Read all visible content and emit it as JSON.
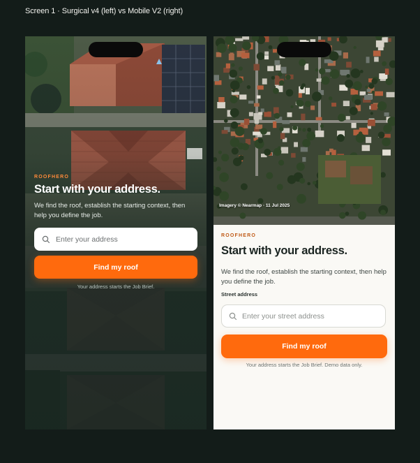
{
  "page": {
    "caption": "Screen 1 · Surgical v4 (left) vs Mobile V2 (right)"
  },
  "left": {
    "eyebrow": "ROOFHERO",
    "title": "Start with your address.",
    "description": "We find the roof, establish the starting context, then help you define the job.",
    "search_placeholder": "Enter your address",
    "button_label": "Find my roof",
    "hint": "Your address starts the Job Brief."
  },
  "right": {
    "imagery_credit": "Imagery © Nearmap · 11 Jul 2025",
    "eyebrow": "ROOFHERO",
    "title": "Start with your address.",
    "description": "We find the roof, establish the starting context, then help you define the job.",
    "field_label": "Street address",
    "search_placeholder": "Enter your street address",
    "button_label": "Find my roof",
    "hint": "Your address starts the Job Brief. Demo data only."
  },
  "colors": {
    "background": "#131c19",
    "accent": "#ff6a0d",
    "eyebrow_dark": "#ff8a3a",
    "eyebrow_light": "#c05a16",
    "panel": "#faf9f5"
  },
  "icons": [
    "search-icon",
    "search-icon"
  ]
}
